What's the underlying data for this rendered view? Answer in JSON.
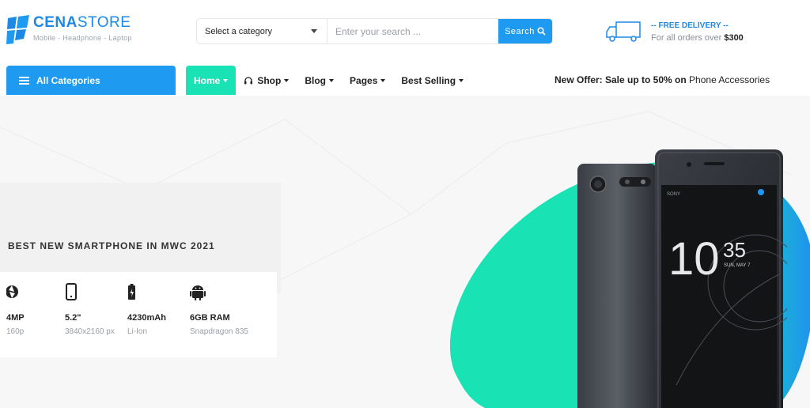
{
  "header": {
    "logo_bold": "CENA",
    "logo_light": "STORE",
    "logo_tagline": "Mobile - Headphone - Laptop",
    "search": {
      "category_label": "Select a category",
      "placeholder": "Enter your search ...",
      "button_label": "Search"
    },
    "delivery": {
      "title": "-- FREE DELIVERY --",
      "subtitle": "For all orders over",
      "amount": "$300"
    }
  },
  "nav": {
    "all_categories": "All Categories",
    "items": [
      {
        "label": "Home",
        "active": true
      },
      {
        "label": "Shop"
      },
      {
        "label": "Blog"
      },
      {
        "label": "Pages"
      },
      {
        "label": "Best Selling"
      }
    ],
    "offer_bold": "New Offer: Sale up to 50% on",
    "offer_rest": "Phone Accessories"
  },
  "hero": {
    "subtitle": "BEST NEW SMARTPHONE IN MWC 2021",
    "specs": [
      {
        "icon": "camera-aperture-icon",
        "value": "4MP",
        "detail": "160p"
      },
      {
        "icon": "smartphone-icon",
        "value": "5.2\"",
        "detail": "3840x2160 px"
      },
      {
        "icon": "battery-charging-icon",
        "value": "4230mAh",
        "detail": "Li-Ion"
      },
      {
        "icon": "android-icon",
        "value": "6GB RAM",
        "detail": "Snapdragon 835"
      }
    ],
    "phone_screen": {
      "hour": "10",
      "minute": "35",
      "date": "SUN, MAY 7"
    }
  },
  "colors": {
    "brand_blue": "#1e9bf0",
    "accent_teal": "#19e2b4"
  }
}
